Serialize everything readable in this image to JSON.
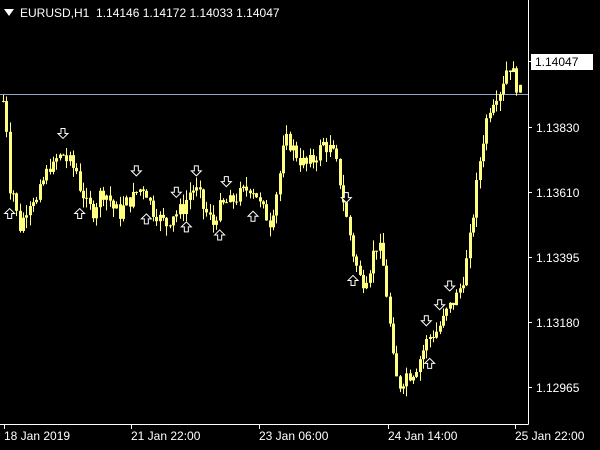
{
  "header": {
    "symbol_timeframe": "EURUSD,H1",
    "ohlc": "1.14146 1.14172 1.14033 1.14047"
  },
  "current_price_label": "1.14047",
  "colors": {
    "background": "#000000",
    "candle": "#ffff80",
    "axis": "#ffffff",
    "price_line": "#8fa8c8"
  },
  "icons": {
    "up_arrow": "up-arrow-icon",
    "down_arrow": "down-arrow-icon"
  },
  "chart_data": {
    "type": "candlestick",
    "title": "EURUSD,H1",
    "y_ticks": [
      "1.13830",
      "1.13610",
      "1.13395",
      "1.13180",
      "1.12965"
    ],
    "x_ticks": [
      "18 Jan 2019",
      "21 Jan 22:00",
      "23 Jan 06:00",
      "24 Jan 14:00",
      "25 Jan 22:00"
    ],
    "ylim": [
      1.1285,
      1.143
    ],
    "current_price": 1.14047,
    "close_path": [
      1.1402,
      1.1392,
      1.137,
      1.1368,
      1.136,
      1.1355,
      1.1358,
      1.1362,
      1.1365,
      1.1366,
      1.1364,
      1.1368,
      1.1372,
      1.1375,
      1.1378,
      1.1377,
      1.138,
      1.1381,
      1.1382,
      1.138,
      1.1379,
      1.1377,
      1.1376,
      1.137,
      1.1367,
      1.1363,
      1.1362,
      1.1361,
      1.1364,
      1.1367,
      1.1368,
      1.1367,
      1.1365,
      1.1362,
      1.1361,
      1.136,
      1.1362,
      1.1364,
      1.1365,
      1.1366,
      1.1368,
      1.1369,
      1.137,
      1.1368,
      1.1364,
      1.1361,
      1.136,
      1.1358,
      1.1357,
      1.1356,
      1.1358,
      1.136,
      1.136,
      1.1361,
      1.1362,
      1.1365,
      1.1368,
      1.1369,
      1.1368,
      1.1366,
      1.1362,
      1.136,
      1.1358,
      1.1356,
      1.136,
      1.1362,
      1.1363,
      1.1364,
      1.1364,
      1.1365,
      1.1366,
      1.1367,
      1.1368,
      1.1369,
      1.137,
      1.1369,
      1.1367,
      1.1363,
      1.1361,
      1.1359,
      1.1357,
      1.1362,
      1.1368,
      1.1375,
      1.1383,
      1.1387,
      1.1386,
      1.1384,
      1.1382,
      1.138,
      1.1379,
      1.1378,
      1.1379,
      1.138,
      1.1382,
      1.1384,
      1.1386,
      1.1385,
      1.1384,
      1.1382,
      1.1378,
      1.1372,
      1.1365,
      1.1358,
      1.1352,
      1.1345,
      1.134,
      1.1336,
      1.1335,
      1.1337,
      1.134,
      1.1345,
      1.1348,
      1.1346,
      1.134,
      1.133,
      1.1318,
      1.1305,
      1.1298,
      1.1296,
      1.1298,
      1.13,
      1.13,
      1.1301,
      1.1303,
      1.1306,
      1.1309,
      1.1312,
      1.1314,
      1.1315,
      1.1316,
      1.1318,
      1.132,
      1.1323,
      1.1325,
      1.1327,
      1.1329,
      1.1332,
      1.1336,
      1.1342,
      1.135,
      1.136,
      1.137,
      1.138,
      1.1388,
      1.1395,
      1.14,
      1.1403,
      1.1405,
      1.1406,
      1.141,
      1.1414,
      1.1415,
      1.1412,
      1.1408,
      1.1405
    ],
    "up_arrows_at": [
      2,
      23,
      43,
      55,
      65,
      75,
      105,
      128
    ],
    "down_arrows_at": [
      18,
      40,
      52,
      58,
      67,
      103,
      127,
      131,
      134
    ]
  }
}
